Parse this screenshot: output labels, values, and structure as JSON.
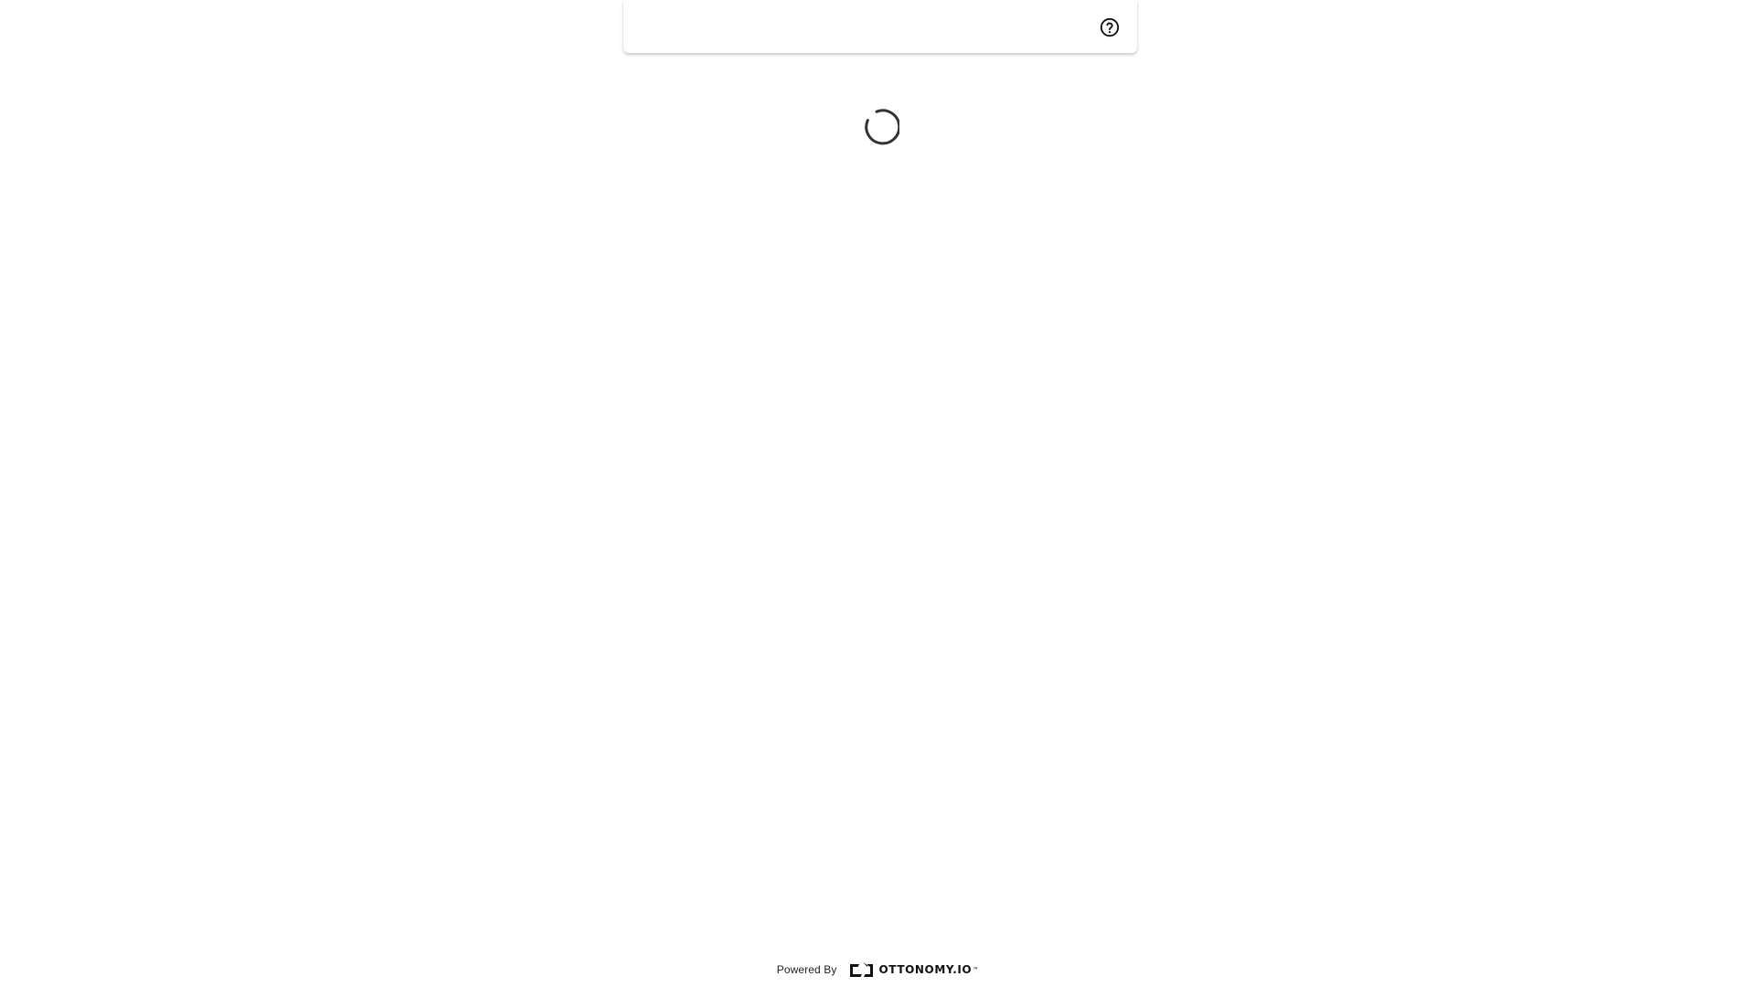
{
  "header": {
    "help_icon": "help-circle-icon"
  },
  "main": {
    "loading_indicator": "spinner",
    "loading_color": "#333333"
  },
  "footer": {
    "powered_by_label": "Powered By",
    "brand_name": "OTTONOMY.IO",
    "brand_trademark": "™",
    "brand_color": "#111111"
  }
}
